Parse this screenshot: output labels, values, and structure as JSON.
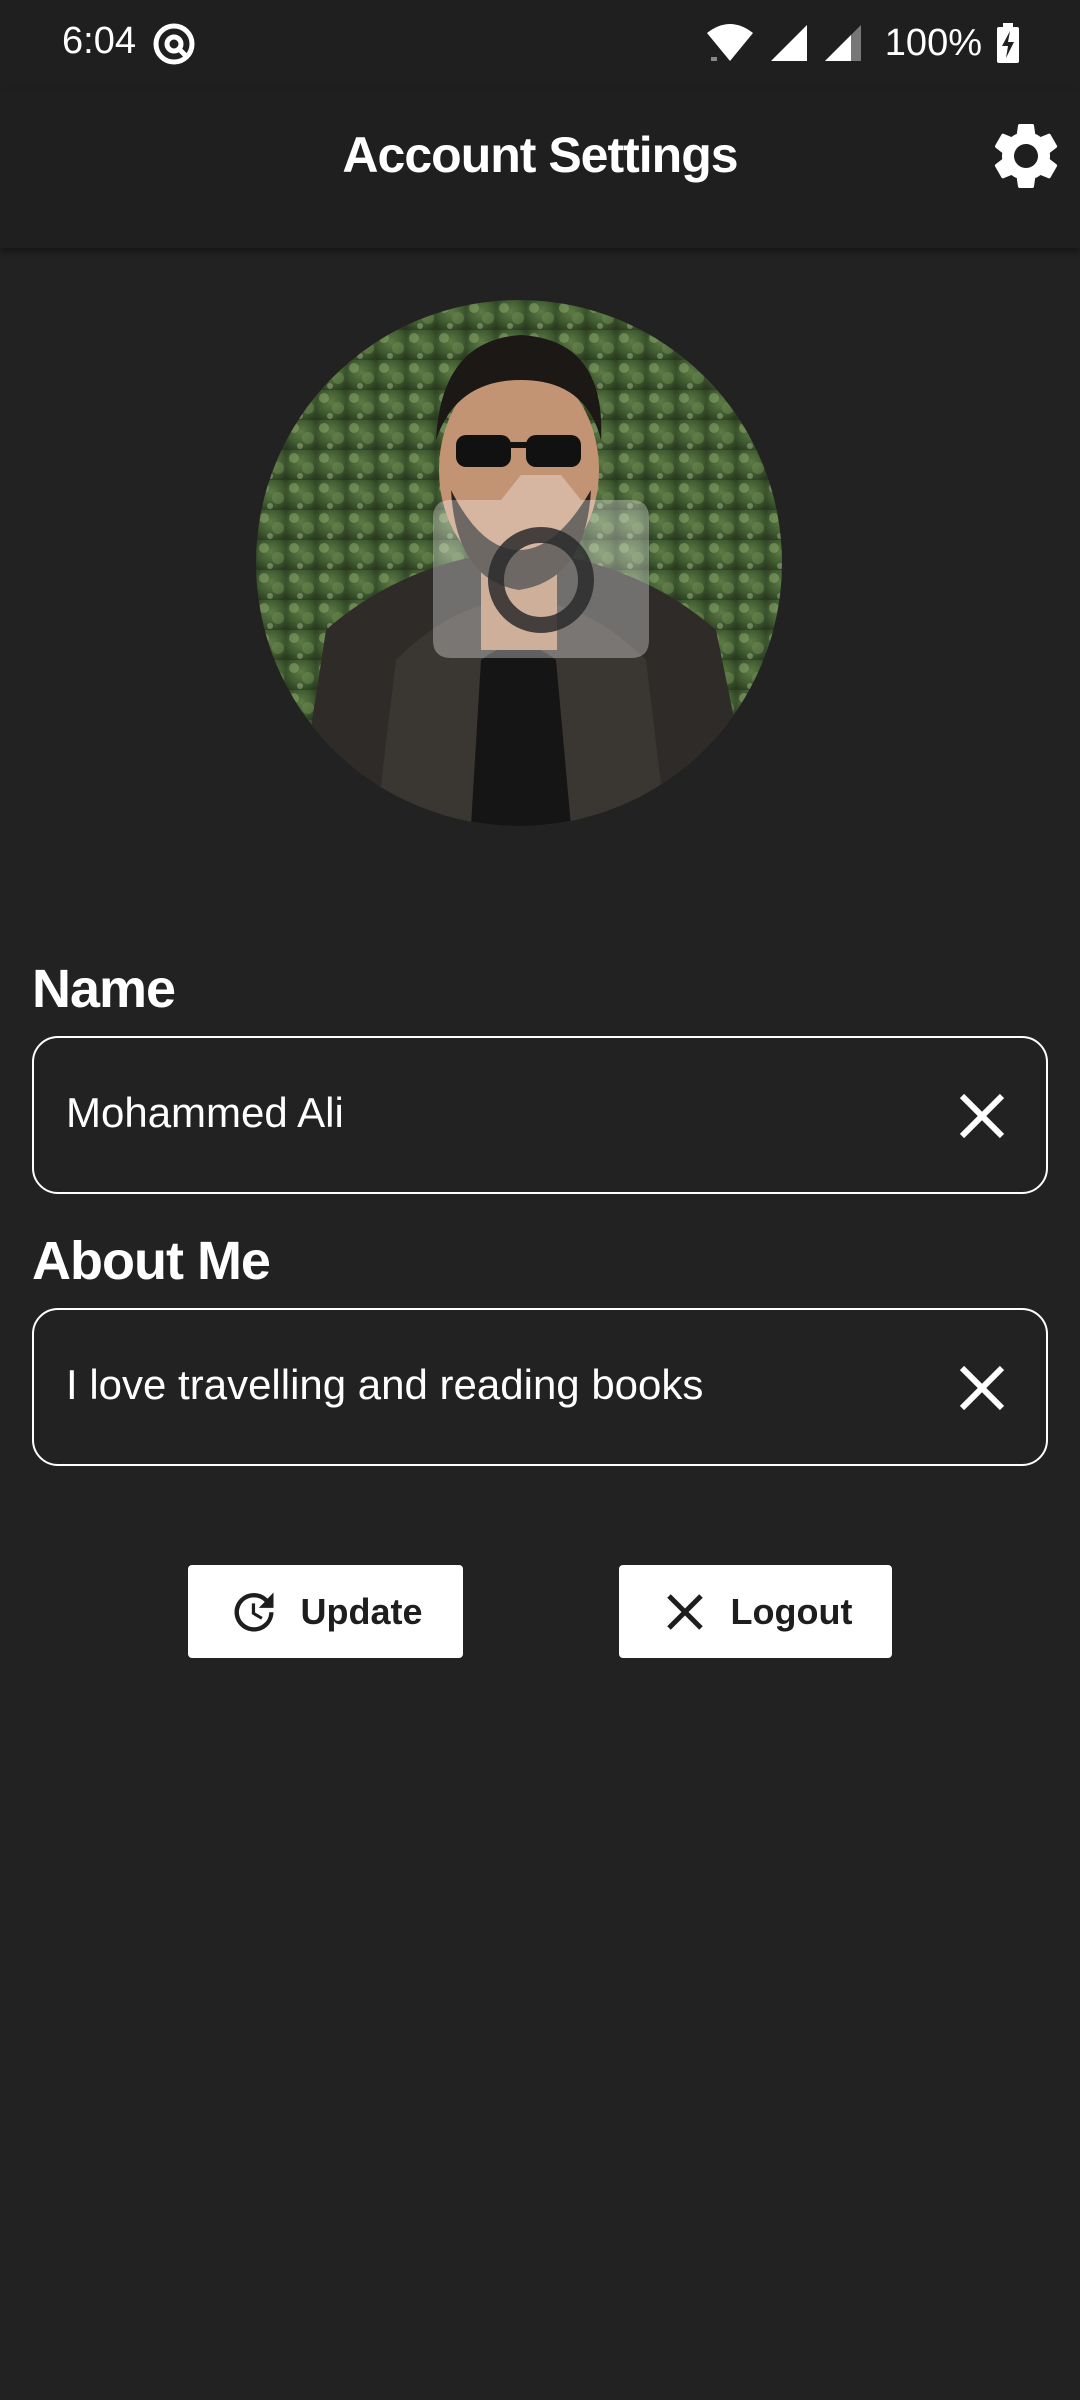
{
  "status_bar": {
    "time": "6:04",
    "battery": "100%",
    "icons": [
      "at-sign-icon",
      "wifi-icon",
      "signal-icon",
      "signal-icon",
      "battery-charging-icon"
    ]
  },
  "app_bar": {
    "title": "Account Settings",
    "settings_icon": "gear-icon"
  },
  "profile": {
    "avatar_icon": "camera-icon"
  },
  "form": {
    "name_label": "Name",
    "name_value": "Mohammed Ali",
    "about_label": "About Me",
    "about_value": "I love travelling and reading books"
  },
  "actions": {
    "update_label": "Update",
    "logout_label": "Logout"
  },
  "colors": {
    "background": "#222222",
    "surface": "#1f1f1f",
    "text": "#ffffff",
    "button_bg": "#ffffff",
    "button_text": "#1e1e1e"
  }
}
